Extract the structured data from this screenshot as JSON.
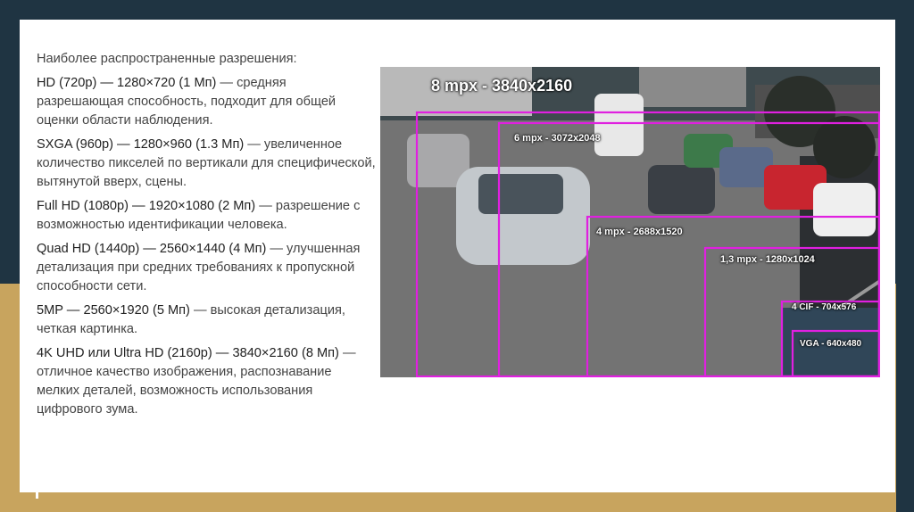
{
  "intro": "Наиболее распространенные разрешения:",
  "items": [
    {
      "heading": "HD (720p) — 1280×720 (1 Мп)",
      "desc": " — средняя разрешающая способность, подходит для общей оценки области наблюдения."
    },
    {
      "heading": "SXGA (960p) — 1280×960 (1.3 Мп)",
      "desc": " — увеличенное количество пикселей по вертикали для специфической, вытянутой вверх, сцены."
    },
    {
      "heading": "Full HD (1080p) — 1920×1080 (2 Мп)",
      "desc": " — разрешение с возможностью идентификации человека."
    },
    {
      "heading": "Quad HD (1440p) — 2560×1440 (4 Мп)",
      "desc": " — улучшенная детализация при средних требованиях к пропускной способности сети."
    },
    {
      "heading": "5MP — 2560×1920 (5 Мп)",
      "desc": " — высокая детализация, четкая картинка."
    },
    {
      "heading": "4K UHD или Ultra HD (2160p) — 3840×2160 (8 Мп)",
      "desc": " — отличное качество изображения, распознавание мелких деталей, возможность использования цифрового зума."
    }
  ],
  "photo": {
    "labels": {
      "mpx8": "8 mpx - 3840x2160",
      "mpx6": "6 mpx - 3072x2048",
      "mpx4": "4 mpx - 2688x1520",
      "mpx13": "1,3 mpx - 1280x1024",
      "cif4": "4 CIF - 704x576",
      "vga": "VGA - 640x480"
    },
    "frame_color": "#e020e0"
  }
}
